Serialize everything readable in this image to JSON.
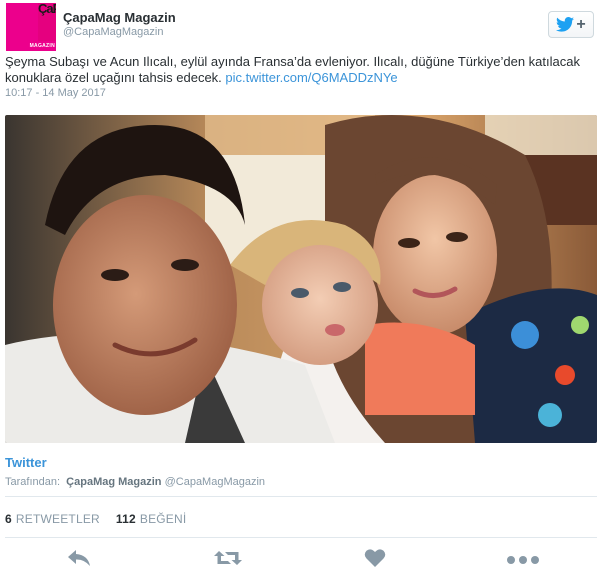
{
  "account": {
    "display_name": "ÇapaMag Magazin",
    "screen_name": "@CapaMagMagazin",
    "avatar_text": "ÇaPa",
    "avatar_subtext": "MAGAZIN"
  },
  "tweet": {
    "text_before_link": "Şeyma Subaşı ve Acun Ilıcalı, eylül ayında Fransa’da evleniyor. Ilıcalı, düğüne Türkiye’den katılacak konuklara özel uçağını tahsis edecek. ",
    "link_text": "pic.twitter.com/Q6MADDzNYe",
    "timestamp": "10:17 - 14 May 2017"
  },
  "source": {
    "label": "Twitter",
    "by_prefix": "Tarafından:",
    "by_name": "ÇapaMag Magazin",
    "by_handle": "@CapaMagMagazin"
  },
  "stats": {
    "retweets_count": "6",
    "retweets_label": "RETWEETLER",
    "likes_count": "112",
    "likes_label": "BEĞENİ"
  },
  "icons": {
    "follow": "twitter-bird-plus-icon",
    "reply": "reply-arrow-icon",
    "retweet": "retweet-icon",
    "like": "heart-icon",
    "more": "more-dots-icon"
  },
  "colors": {
    "brand_pink": "#ec008c",
    "link_blue": "#3b94d9",
    "twitter_blue": "#1da1f2",
    "muted": "#8899a6"
  }
}
